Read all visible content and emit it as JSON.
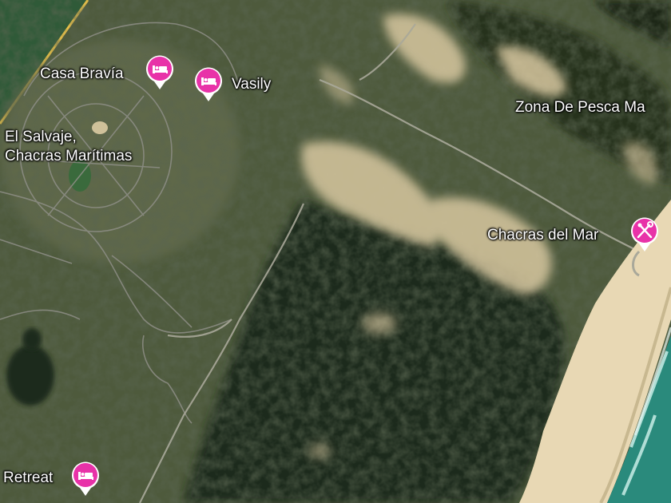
{
  "map": {
    "type": "satellite",
    "colors": {
      "forest": "#1f2a1c",
      "scrub": "#4e5a3c",
      "sand": "#d8c8a0",
      "beach": "#e8d8b4",
      "ocean": "#2a8a7c",
      "surf": "#bfe8e0",
      "pin_fill": "#e832a8",
      "road": "#9a9a92",
      "highway": "#e8c04a"
    },
    "places": [
      {
        "name": "Casa Bravía",
        "icon": "hotel-bed-icon"
      },
      {
        "name": "Vasily",
        "icon": "hotel-bed-icon"
      },
      {
        "name": "El Salvaje,",
        "name_line2": "Chacras Marítimas"
      },
      {
        "name": "Zona De Pesca Ma"
      },
      {
        "name": "Chacras del Mar",
        "icon": "fishing-icon"
      },
      {
        "name": "Retreat",
        "icon": "hotel-bed-icon"
      }
    ]
  }
}
